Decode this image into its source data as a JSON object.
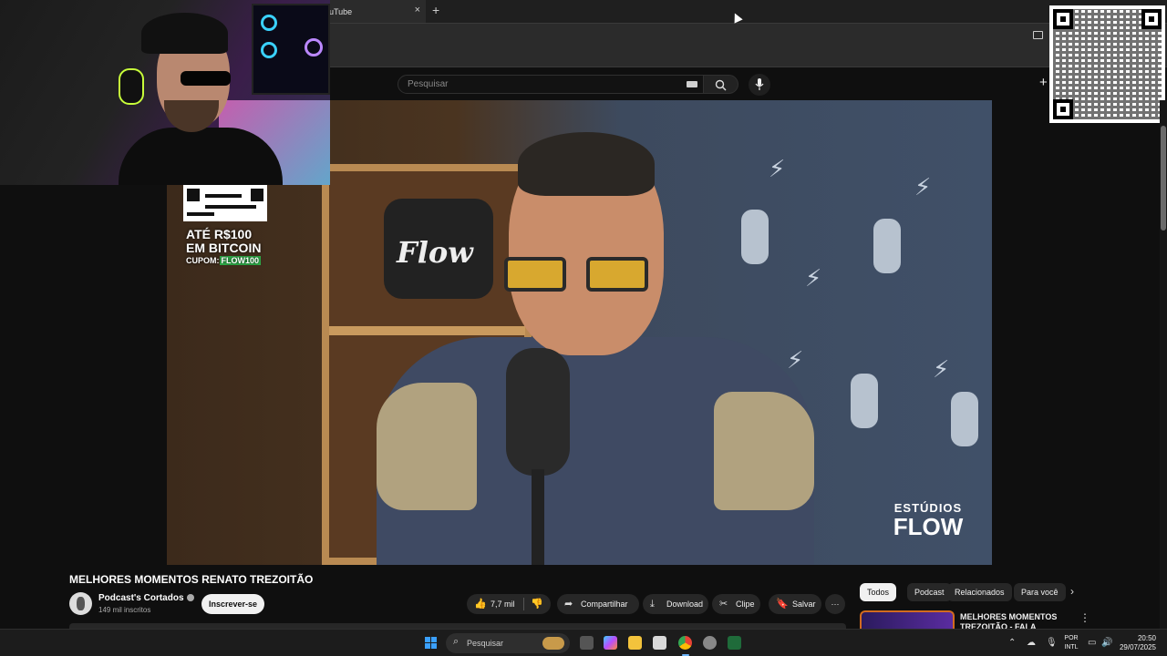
{
  "browser": {
    "tab_title": "uTube",
    "tab_close": "×",
    "new_tab": "+"
  },
  "youtube": {
    "search_placeholder": "Pesquisar",
    "create_icon": "+"
  },
  "video": {
    "promo_line1": "ATÉ R$100",
    "promo_line2": "EM BITCOIN",
    "promo_cupom": "CUPOM:",
    "promo_code": "FLOW100",
    "watermark_line1": "ESTÚDIOS",
    "watermark_line2": "FLOW",
    "sign_text": "Flow"
  },
  "details": {
    "title": "MELHORES MOMENTOS RENATO TREZOITÃO",
    "channel_name": "Podcast's Cortados",
    "subscribers": "149 mil inscritos",
    "subscribe_label": "Inscrever-se",
    "likes": "7,7 mil",
    "share_label": "Compartilhar",
    "download_label": "Download",
    "clip_label": "Clipe",
    "save_label": "Salvar",
    "more_label": "···"
  },
  "sidebar": {
    "chips": [
      "Todos",
      "Podcast",
      "Relacionados",
      "Para você"
    ],
    "recommended_title": "MELHORES MOMENTOS TREZOITÃO - FALA GLAUBER"
  },
  "taskbar": {
    "search_label": "Pesquisar",
    "lang_line1": "POR",
    "lang_line2": "INTL",
    "time": "20:50",
    "date": "29/07/2025"
  },
  "icons": {
    "search": "search-icon",
    "mic": "microphone-icon",
    "like": "thumbs-up-icon",
    "dislike": "thumbs-down-icon",
    "share": "share-icon",
    "download": "download-icon",
    "clip": "scissors-icon",
    "save": "bookmark-icon"
  },
  "colors": {
    "background": "#0f0f0f",
    "pill": "#272727",
    "subscribe_bg": "#f1f1f1",
    "promo_code_bg": "#2fae4a"
  }
}
